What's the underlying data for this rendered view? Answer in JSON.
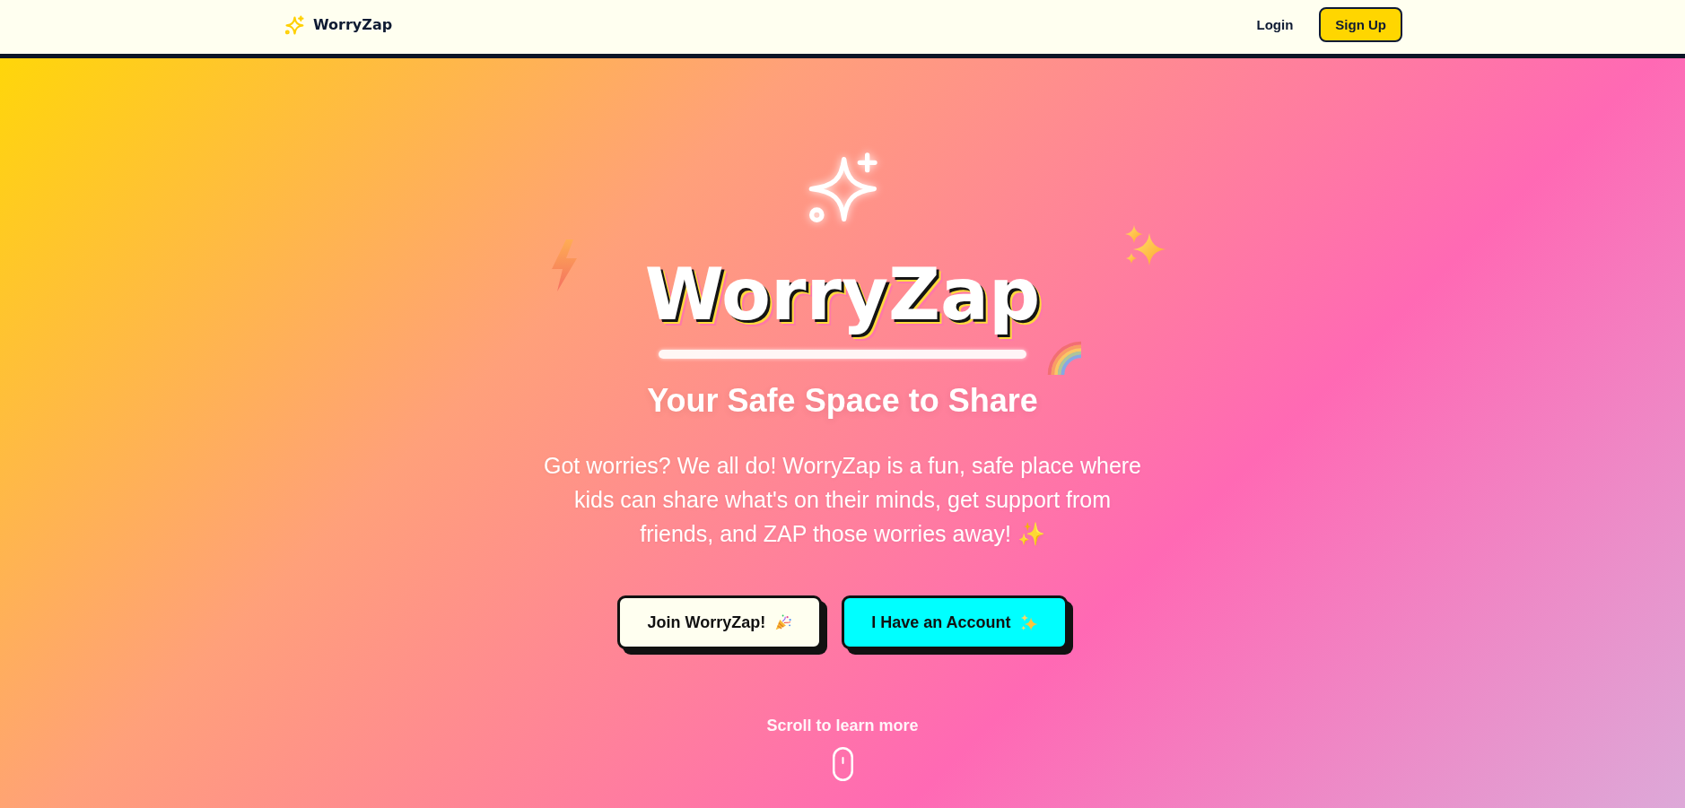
{
  "header": {
    "brand": "WorryZap",
    "nav": [
      {
        "kind": "link",
        "label": "Login"
      },
      {
        "kind": "button",
        "label": "Sign Up"
      }
    ]
  },
  "hero": {
    "title": "WorryZap",
    "subtitle": "Your Safe Space to Share",
    "intro": "Got worries? We all do! WorryZap is a fun, safe place where kids can share what's on their minds, get support from friends, and ZAP those worries away! ✨",
    "actions": [
      {
        "kind": "primary",
        "label": "Join WorryZap!"
      },
      {
        "kind": "secondary",
        "label": "I Have an Account"
      }
    ]
  },
  "scroll_hint": {
    "label": "Scroll to learn more"
  }
}
